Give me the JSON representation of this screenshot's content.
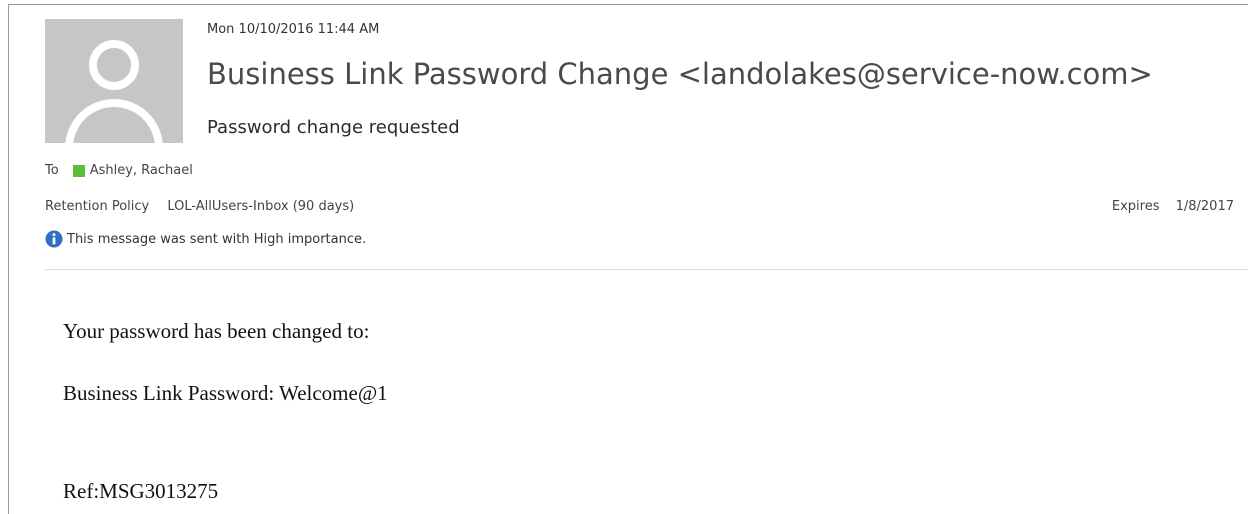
{
  "header": {
    "date": "Mon 10/10/2016 11:44 AM",
    "sender": "Business Link Password Change <landolakes@service-now.com>",
    "subject": "Password change requested",
    "to_label": "To",
    "recipient": "Ashley, Rachael",
    "retention_label": "Retention Policy",
    "retention_value": "LOL-AllUsers-Inbox (90 days)",
    "expires_label": "Expires",
    "expires_value": "1/8/2017",
    "importance_text": "This message was sent with High importance."
  },
  "body": {
    "line1": "Your password has been changed to:",
    "line2": "Business Link Password: Welcome@1",
    "line3": "Ref:MSG3013275"
  },
  "icons": {
    "avatar": "person-placeholder-icon",
    "presence": "presence-available-icon",
    "importance": "info-icon"
  },
  "colors": {
    "presence_green": "#5cbf3c",
    "info_blue": "#2e6fc2",
    "avatar_gray": "#c6c6c6"
  }
}
